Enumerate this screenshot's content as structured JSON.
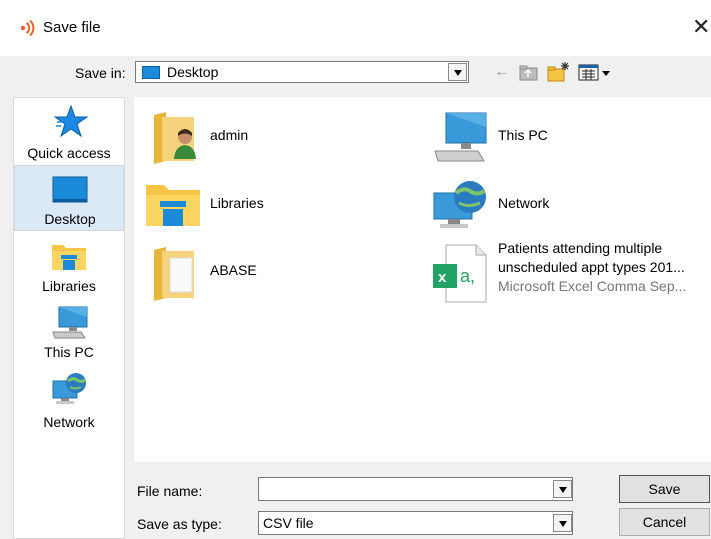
{
  "window": {
    "title": "Save file"
  },
  "toolbar": {
    "save_in_label": "Save in:",
    "save_in_value": "Desktop"
  },
  "places": [
    {
      "label": "Quick access",
      "icon": "star-icon"
    },
    {
      "label": "Desktop",
      "icon": "desktop-icon",
      "selected": true
    },
    {
      "label": "Libraries",
      "icon": "libraries-icon"
    },
    {
      "label": "This PC",
      "icon": "this-pc-icon"
    },
    {
      "label": "Network",
      "icon": "network-icon"
    }
  ],
  "files": [
    {
      "name": "admin",
      "icon": "user-folder-icon"
    },
    {
      "name": "This PC",
      "icon": "this-pc-icon"
    },
    {
      "name": "Libraries",
      "icon": "libraries-folder-icon"
    },
    {
      "name": "Network",
      "icon": "network-icon"
    },
    {
      "name": "ABASE",
      "icon": "folder-icon"
    },
    {
      "name": "Patients attending multiple",
      "name_line2": "unscheduled appt types 201...",
      "subtitle": "Microsoft Excel Comma Sep...",
      "icon": "excel-csv-icon"
    }
  ],
  "footer": {
    "file_name_label": "File name:",
    "file_name_value": "",
    "save_type_label": "Save as type:",
    "save_type_value": "CSV file",
    "save_button": "Save",
    "cancel_button": "Cancel"
  },
  "colors": {
    "accent": "#1b8ad8",
    "folder": "#f6c447",
    "excel": "#21a366",
    "selection": "#dbe9f7"
  }
}
